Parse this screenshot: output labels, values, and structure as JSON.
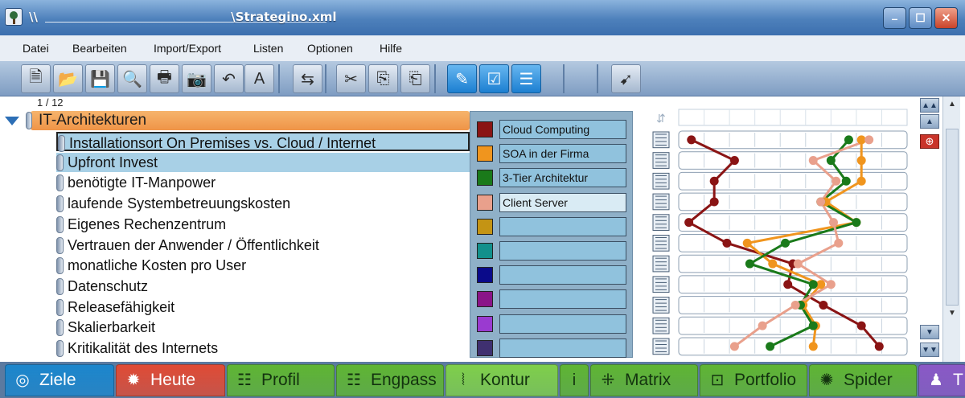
{
  "window": {
    "title": "\\\\                                              \\Strategino.xml",
    "controls": {
      "minimize": "–",
      "maximize": "☐",
      "close": "✕"
    }
  },
  "menu": [
    "Datei",
    "Bearbeiten",
    "Import/Export",
    "Listen",
    "Optionen",
    "Hilfe"
  ],
  "toolbar": {
    "buttons": [
      {
        "name": "new-document-icon",
        "glyph": "🗎"
      },
      {
        "name": "open-folder-icon",
        "glyph": "📂"
      },
      {
        "name": "save-icon",
        "glyph": "💾"
      },
      {
        "name": "search-icon",
        "glyph": "🔍"
      },
      {
        "name": "print-icon",
        "glyph": "🖶"
      },
      {
        "name": "camera-icon",
        "glyph": "📷"
      },
      {
        "name": "undo-icon",
        "glyph": "↶"
      },
      {
        "name": "font-icon",
        "glyph": "A"
      },
      {
        "name": "import-icon",
        "glyph": "⇆"
      },
      {
        "name": "cut-icon",
        "glyph": "✂"
      },
      {
        "name": "copy-icon",
        "glyph": "⎘"
      },
      {
        "name": "paste-icon",
        "glyph": "⎗"
      },
      {
        "name": "comment-icon",
        "glyph": "✎"
      },
      {
        "name": "checklist-icon",
        "glyph": "☑"
      },
      {
        "name": "list-indent-icon",
        "glyph": "☰"
      },
      {
        "name": "pin-icon",
        "glyph": "➹"
      }
    ]
  },
  "page_indicator": "1 / 12",
  "group": {
    "label": "IT-Architekturen"
  },
  "criteria": [
    "Installationsort On Premises vs. Cloud / Internet",
    "Upfront Invest",
    "benötigte IT-Manpower",
    "laufende Systembetreuungskosten",
    "Eigenes Rechenzentrum",
    "Vertrauen der Anwender / Öffentlichkeit",
    "monatliche Kosten pro User",
    "Datenschutz",
    "Releasefähigkeit",
    "Skalierbarkeit",
    "Kritikalität des Internets"
  ],
  "legend": [
    {
      "label": "Cloud Computing",
      "color": "#8a1414"
    },
    {
      "label": "SOA in der Firma",
      "color": "#f0951e"
    },
    {
      "label": "3-Tier Architektur",
      "color": "#1a7a1a"
    },
    {
      "label": "Client Server",
      "color": "#e9a08c"
    },
    {
      "label": "",
      "color": "#c49414"
    },
    {
      "label": "",
      "color": "#12908c"
    },
    {
      "label": "",
      "color": "#0a0a8a"
    },
    {
      "label": "",
      "color": "#8a1488"
    },
    {
      "label": "",
      "color": "#9a3ad0"
    },
    {
      "label": "",
      "color": "#3f3070"
    }
  ],
  "chart_data": {
    "type": "line",
    "scale_divisions": 9,
    "rows": 11,
    "series": [
      {
        "name": "Cloud Computing",
        "color": "#8a1414",
        "values": [
          0.5,
          2.2,
          1.4,
          1.4,
          0.4,
          1.9,
          4.5,
          4.3,
          5.7,
          7.2,
          7.9
        ]
      },
      {
        "name": "SOA in der Firma",
        "color": "#f0951e",
        "values": [
          7.2,
          7.2,
          7.2,
          5.8,
          7.0,
          2.7,
          3.7,
          5.6,
          4.9,
          5.4,
          5.3
        ]
      },
      {
        "name": "3-Tier Architektur",
        "color": "#1a7a1a",
        "values": [
          6.7,
          6.0,
          6.6,
          5.6,
          7.0,
          4.2,
          2.8,
          5.3,
          4.8,
          5.3,
          3.6
        ]
      },
      {
        "name": "Client Server",
        "color": "#e9a08c",
        "values": [
          7.5,
          5.3,
          6.2,
          5.6,
          6.1,
          6.3,
          4.7,
          6.0,
          4.6,
          3.3,
          2.2
        ]
      }
    ]
  },
  "tabs": [
    {
      "label": "Ziele",
      "icon": "target-icon",
      "glyph": "◎",
      "bg": "#1c86cc"
    },
    {
      "label": "Heute",
      "icon": "gear-icon",
      "glyph": "✹",
      "bg": "#e04b35"
    },
    {
      "label": "Profil",
      "icon": "profile-icon",
      "glyph": "☷",
      "bg": "#5fb533"
    },
    {
      "label": "Engpass",
      "icon": "bottleneck-icon",
      "glyph": "☷",
      "bg": "#5fb533"
    },
    {
      "label": "Kontur",
      "icon": "contour-icon",
      "glyph": "⦚",
      "bg": "#7fcf4a"
    },
    {
      "label": "",
      "icon": "info-icon",
      "glyph": "i",
      "bg": "#5fb533"
    },
    {
      "label": "Matrix",
      "icon": "matrix-icon",
      "glyph": "⁜",
      "bg": "#5fb533"
    },
    {
      "label": "Portfolio",
      "icon": "portfolio-icon",
      "glyph": "⊡",
      "bg": "#5fb533"
    },
    {
      "label": "Spider",
      "icon": "spider-icon",
      "glyph": "✺",
      "bg": "#5fb533"
    },
    {
      "label": "T",
      "icon": "team-icon",
      "glyph": "♟",
      "bg": "#8a58c6"
    }
  ]
}
